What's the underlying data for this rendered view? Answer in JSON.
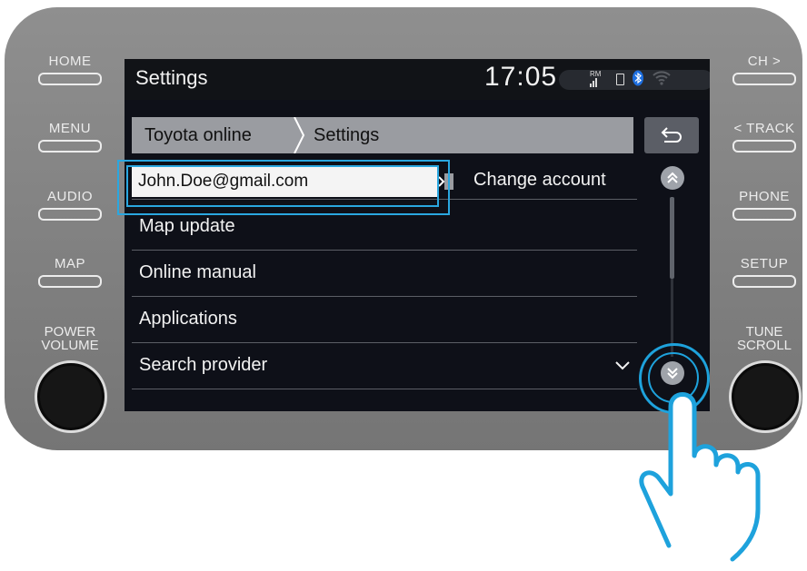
{
  "hardware": {
    "left_buttons": [
      "HOME",
      "MENU",
      "AUDIO",
      "MAP"
    ],
    "right_buttons": [
      "CH >",
      "< TRACK",
      "PHONE",
      "SETUP"
    ],
    "power_volume": [
      "POWER",
      "VOLUME"
    ],
    "tune_scroll": [
      "TUNE",
      "SCROLL"
    ]
  },
  "status_bar": {
    "title": "Settings",
    "clock": "17:05",
    "signal_label": "RM"
  },
  "breadcrumb": [
    "Toyota online",
    "Settings"
  ],
  "account": {
    "email": "John.Doe@gmail.com",
    "change_label": "Change account"
  },
  "menu_items": [
    "Map update",
    "Online manual",
    "Applications",
    "Search provider"
  ],
  "icons": {
    "back": "back-arrow-icon",
    "scroll_up": "chevron-double-up-icon",
    "scroll_down": "chevron-double-down-icon",
    "expand": "chevron-down-icon",
    "hand": "pointing-hand-icon"
  },
  "colors": {
    "highlight": "#1ea2dc",
    "bluetooth": "#1e6fe0",
    "screen_bg": "#0e1018",
    "bezel": "#858585"
  }
}
